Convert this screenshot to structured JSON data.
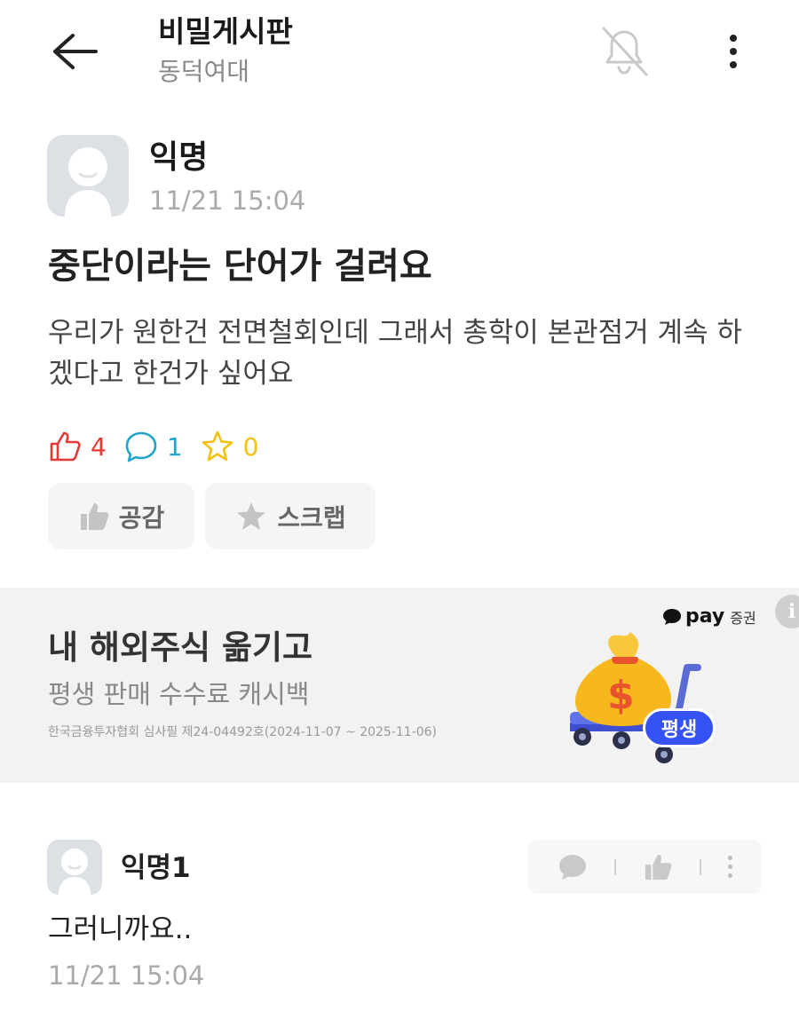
{
  "header": {
    "title": "비밀게시판",
    "school": "동덕여대"
  },
  "post": {
    "author": "익명",
    "time": "11/21 15:04",
    "title": "중단이라는 단어가 걸려요",
    "body": "우리가 원한건 전면철회인데 그래서 총학이 본관점거 계속 하겠다고 한건가 싶어요",
    "stats": {
      "likes": "4",
      "comments": "1",
      "scraps": "0"
    },
    "buttons": {
      "empathy": "공감",
      "scrap": "스크랩"
    }
  },
  "ad": {
    "headline": "내 해외주식 옮기고",
    "subline": "평생 판매 수수료 캐시백",
    "note": "한국금융투자협회 심사필 제24-04492호(2024-11-07 ~ 2025-11-06)",
    "brand_pay": "pay",
    "brand_securities": "증권",
    "badge": "평생",
    "info_icon": "i"
  },
  "comment": {
    "author": "익명1",
    "text": "그러니까요..",
    "time": "11/21 15:04"
  },
  "colors": {
    "like": "#e53935",
    "comment": "#1ea5c8",
    "scrap": "#f4c20d",
    "ad_badge": "#3553f5"
  },
  "icons": {
    "back": "arrow-left-icon",
    "notification": "bell-off-icon",
    "more": "more-vertical-icon",
    "like": "thumbs-up-icon",
    "comment": "speech-bubble-icon",
    "scrap": "star-icon"
  }
}
